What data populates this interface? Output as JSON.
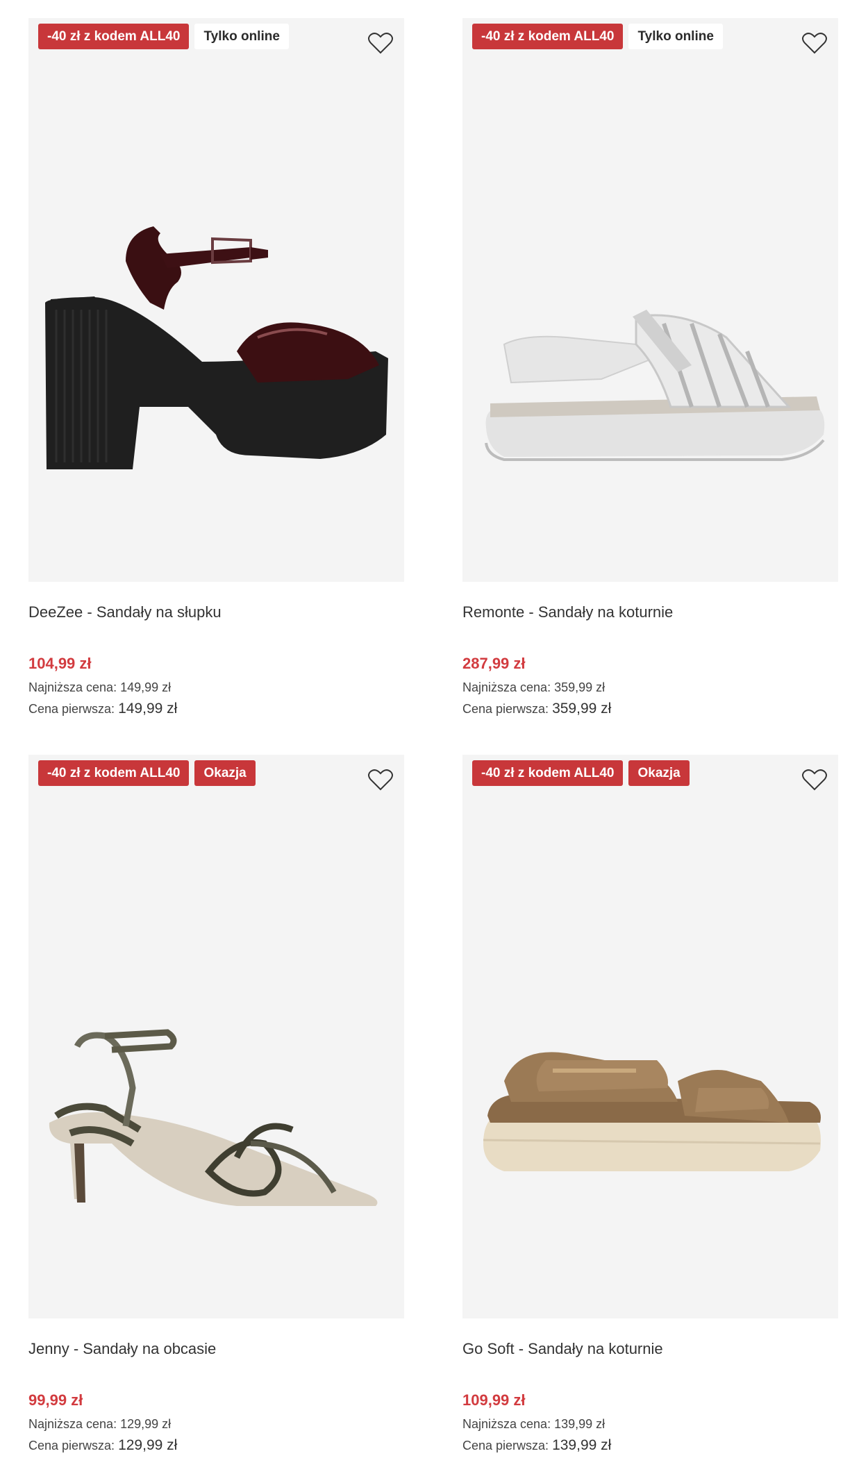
{
  "products": [
    {
      "badges": [
        {
          "text": "-40 zł z kodem ALL40",
          "style": "red"
        },
        {
          "text": "Tylko online",
          "style": "white"
        }
      ],
      "name": "DeeZee - Sandały na słupku",
      "price": "104,99 zł",
      "lowest_label": "Najniższa cena:",
      "lowest_value": "149,99 zł",
      "first_label": "Cena pierwsza:",
      "first_value": "149,99 zł",
      "image": "black platform sandal with burgundy patent straps"
    },
    {
      "badges": [
        {
          "text": "-40 zł z kodem ALL40",
          "style": "red"
        },
        {
          "text": "Tylko online",
          "style": "white"
        }
      ],
      "name": "Remonte - Sandały na koturnie",
      "price": "287,99 zł",
      "lowest_label": "Najniższa cena:",
      "lowest_value": "359,99 zł",
      "first_label": "Cena pierwsza:",
      "first_value": "359,99 zł",
      "image": "silver wedge sandal"
    },
    {
      "badges": [
        {
          "text": "-40 zł z kodem ALL40",
          "style": "red"
        },
        {
          "text": "Okazja",
          "style": "red"
        }
      ],
      "name": "Jenny - Sandały na obcasie",
      "price": "99,99 zł",
      "lowest_label": "Najniższa cena:",
      "lowest_value": "129,99 zł",
      "first_label": "Cena pierwsza:",
      "first_value": "129,99 zł",
      "image": "snake print kitten heel sandal"
    },
    {
      "badges": [
        {
          "text": "-40 zł z kodem ALL40",
          "style": "red"
        },
        {
          "text": "Okazja",
          "style": "red"
        }
      ],
      "name": "Go Soft - Sandały na koturnie",
      "price": "109,99 zł",
      "lowest_label": "Najniższa cena:",
      "lowest_value": "139,99 zł",
      "first_label": "Cena pierwsza:",
      "first_value": "139,99 zł",
      "image": "brown velcro wedge sandal"
    }
  ],
  "icons": {
    "wishlist": "heart-outline-icon"
  },
  "colors": {
    "promo_badge": "#c8373a",
    "sale_price": "#d23b3f",
    "image_bg": "#f4f4f4"
  }
}
